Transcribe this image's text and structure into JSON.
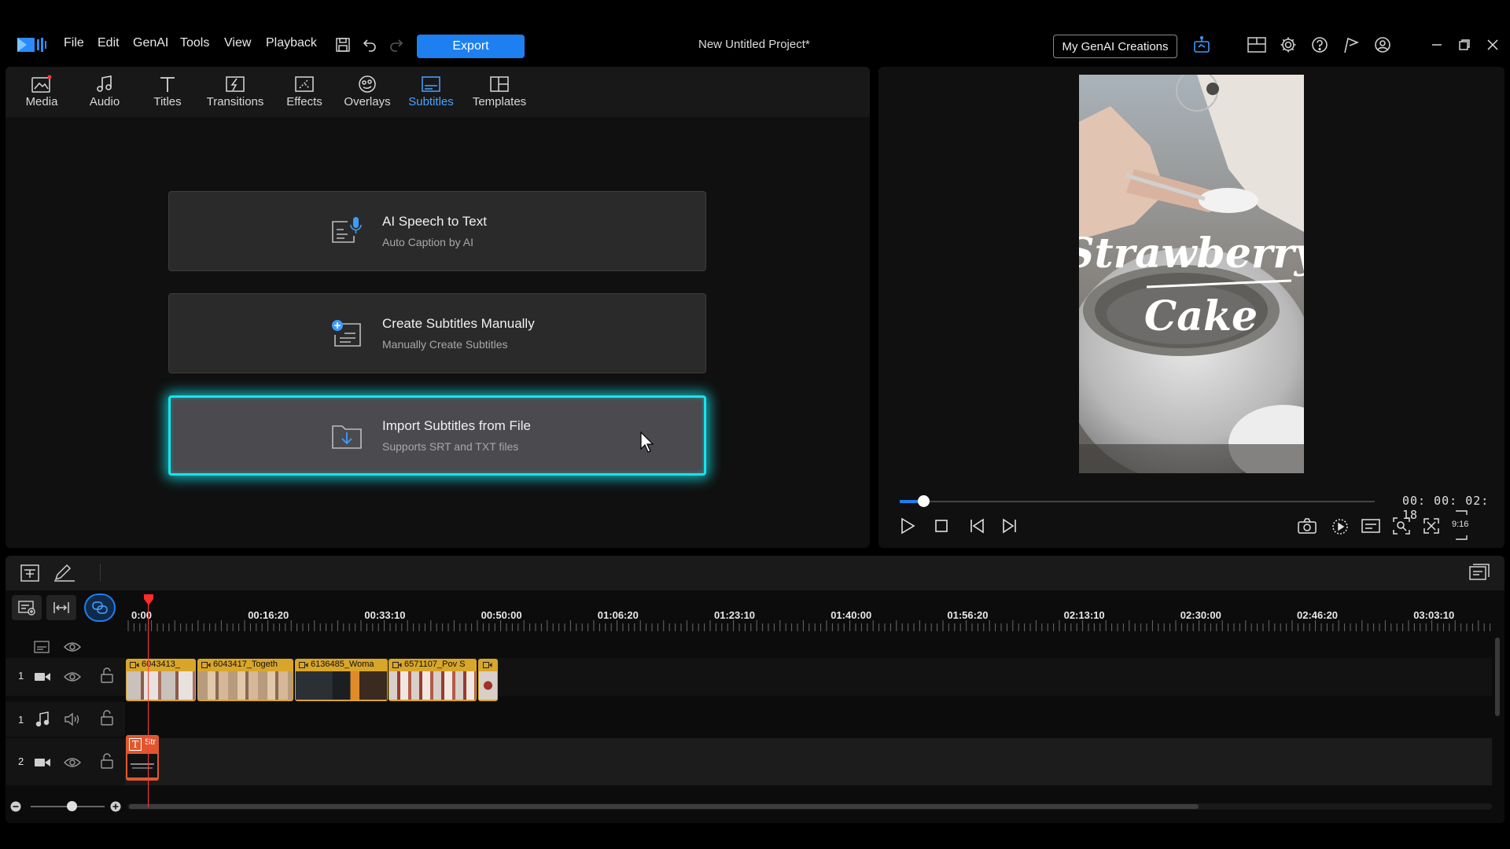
{
  "app": {
    "menu": [
      "File",
      "Edit",
      "GenAI",
      "Tools",
      "View",
      "Playback"
    ],
    "export_label": "Export",
    "project_title": "New Untitled Project*",
    "genai_creations_label": "My GenAI Creations",
    "accent_color": "#1d7ff0",
    "highlight_color": "#16e4ee"
  },
  "library": {
    "tabs": [
      {
        "label": "Media",
        "icon": "media-icon"
      },
      {
        "label": "Audio",
        "icon": "music-note-icon"
      },
      {
        "label": "Titles",
        "icon": "title-t-icon"
      },
      {
        "label": "Transitions",
        "icon": "transition-icon"
      },
      {
        "label": "Effects",
        "icon": "effects-icon"
      },
      {
        "label": "Overlays",
        "icon": "overlays-icon"
      },
      {
        "label": "Subtitles",
        "icon": "subtitles-icon",
        "active": true
      },
      {
        "label": "Templates",
        "icon": "templates-icon"
      }
    ],
    "options": [
      {
        "title": "AI Speech to Text",
        "subtitle": "Auto Caption by AI",
        "icon": "speech-to-text-icon"
      },
      {
        "title": "Create Subtitles Manually",
        "subtitle": "Manually Create Subtitles",
        "icon": "add-subtitle-icon"
      },
      {
        "title": "Import Subtitles from File",
        "subtitle": "Supports SRT and TXT files",
        "icon": "import-folder-icon",
        "highlighted": true
      }
    ]
  },
  "preview": {
    "video_text_line1": "Strawberry",
    "video_text_line2": "Cake",
    "timecode": "00: 00: 02: 18",
    "aspect_ratio": "9:16",
    "playhead_fraction": 0.05
  },
  "timeline": {
    "ruler_labels": [
      "0:00",
      "00:16:20",
      "00:33:10",
      "00:50:00",
      "01:06:20",
      "01:23:10",
      "01:40:00",
      "01:56:20",
      "02:13:10",
      "02:30:00",
      "02:46:20",
      "03:03:10"
    ],
    "tracks": [
      {
        "number": "1",
        "type": "video"
      },
      {
        "number": "1",
        "type": "audio"
      },
      {
        "number": "2",
        "type": "video"
      }
    ],
    "video_clips": [
      {
        "name": "6043413_"
      },
      {
        "name": "6043417_Togeth"
      },
      {
        "name": "6136485_Woma"
      },
      {
        "name": "6571107_Pov S"
      },
      {
        "name": ""
      }
    ],
    "title_clip": {
      "name": "Str"
    }
  }
}
